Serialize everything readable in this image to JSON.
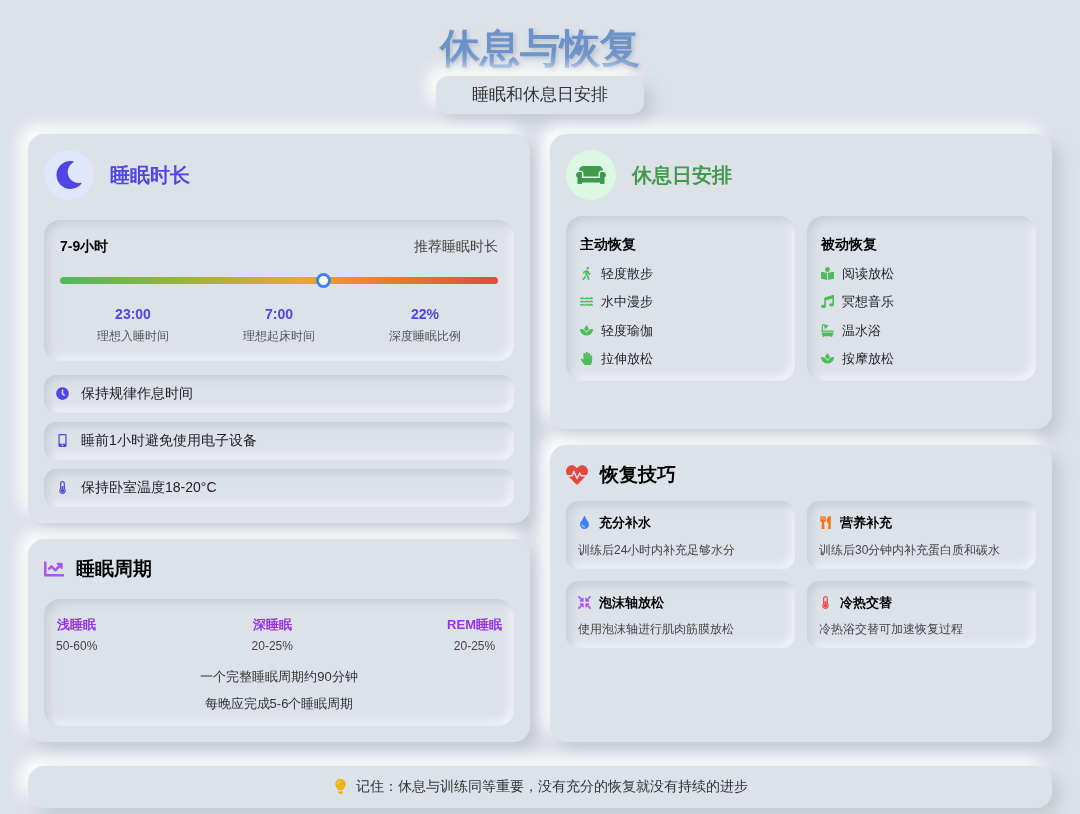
{
  "header": {
    "title": "休息与恢复",
    "subtitle": "睡眠和休息日安排"
  },
  "sleep_duration": {
    "title": "睡眠时长",
    "range": "7-9小时",
    "range_label": "推荐睡眠时长",
    "slider": {
      "level": 0.6
    },
    "stats": [
      {
        "value": "23:00",
        "label": "理想入睡时间"
      },
      {
        "value": "7:00",
        "label": "理想起床时间"
      },
      {
        "value": "22%",
        "label": "深度睡眠比例"
      }
    ],
    "tips": [
      "保持规律作息时间",
      "睡前1小时避免使用电子设备",
      "保持卧室温度18-20°C"
    ]
  },
  "sleep_cycle": {
    "title": "睡眠周期",
    "stages": [
      {
        "name": "浅睡眠",
        "share": "50-60%"
      },
      {
        "name": "深睡眠",
        "share": "20-25%"
      },
      {
        "name": "REM睡眠",
        "share": "20-25%"
      }
    ],
    "notes": [
      "一个完整睡眠周期约90分钟",
      "每晚应完成5-6个睡眠周期"
    ]
  },
  "rest_day": {
    "title": "休息日安排",
    "groups": [
      {
        "title": "主动恢复",
        "items": [
          "轻度散步",
          "水中漫步",
          "轻度瑜伽",
          "拉伸放松"
        ]
      },
      {
        "title": "被动恢复",
        "items": [
          "阅读放松",
          "冥想音乐",
          "温水浴",
          "按摩放松"
        ]
      }
    ]
  },
  "recovery_tips": {
    "title": "恢复技巧",
    "tips": [
      {
        "title": "充分补水",
        "text": "训练后24小时内补充足够水分",
        "color": "#3b82f6"
      },
      {
        "title": "营养补充",
        "text": "训练后30分钟内补充蛋白质和碳水",
        "color": "#f97316"
      },
      {
        "title": "泡沫轴放松",
        "text": "使用泡沫轴进行肌肉筋膜放松",
        "color": "#a855f7"
      },
      {
        "title": "冷热交替",
        "text": "冷热浴交替可加速恢复过程",
        "color": "#ef4444"
      }
    ]
  },
  "footer": {
    "text": "记住：休息与训练同等重要，没有充分的恢复就没有持续的进步"
  }
}
